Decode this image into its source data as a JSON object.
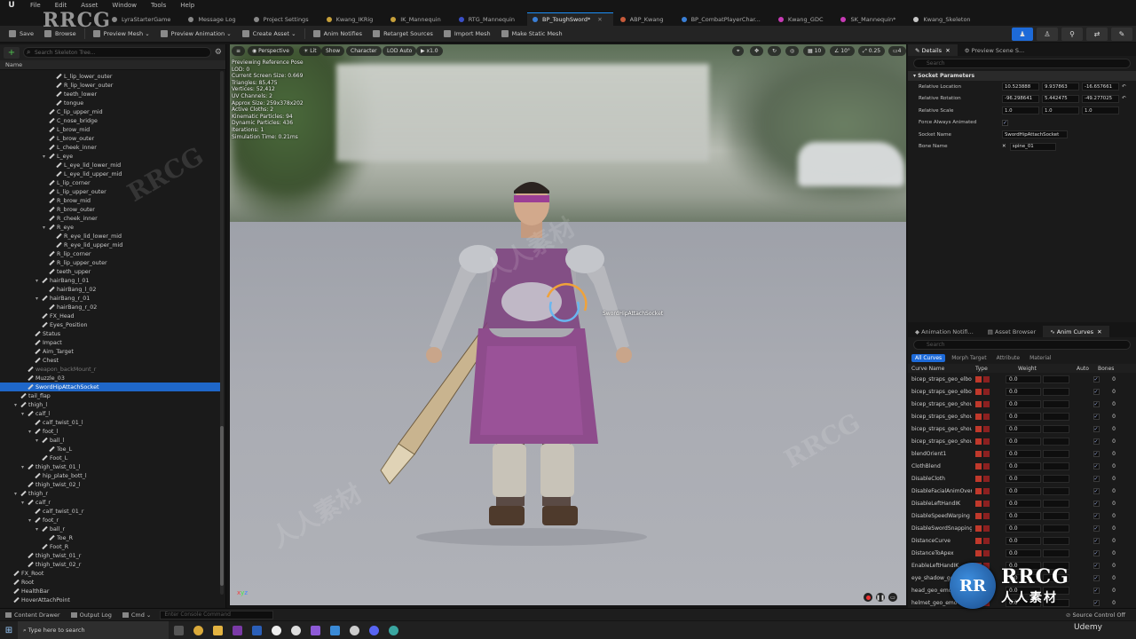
{
  "menubar": {
    "items": [
      "File",
      "Edit",
      "Asset",
      "Window",
      "Tools",
      "Help"
    ]
  },
  "tabs": [
    {
      "label": "LyraStarterGame",
      "color": "#888888",
      "active": false
    },
    {
      "label": "Message Log",
      "color": "#888888",
      "active": false
    },
    {
      "label": "Project Settings",
      "color": "#888888",
      "active": false
    },
    {
      "label": "Kwang_IKRig",
      "color": "#c7a03a",
      "active": false
    },
    {
      "label": "IK_Mannequin",
      "color": "#c7a03a",
      "active": false
    },
    {
      "label": "RTG_Mannequin",
      "color": "#3a4fc7",
      "active": false
    },
    {
      "label": "BP_ToughSword*",
      "color": "#3a7fd6",
      "active": true
    },
    {
      "label": "ABP_Kwang",
      "color": "#c75a3a",
      "active": false
    },
    {
      "label": "BP_CombatPlayerChar...",
      "color": "#3a7fd6",
      "active": false
    },
    {
      "label": "Kwang_GDC",
      "color": "#c73ab5",
      "active": false
    },
    {
      "label": "SK_Mannequin*",
      "color": "#c73ab5",
      "active": false
    },
    {
      "label": "Kwang_Skeleton",
      "color": "#c7c7c7",
      "active": false
    }
  ],
  "toolbar": {
    "buttons": [
      "Save",
      "Browse",
      "Preview Mesh",
      "Preview Animation",
      "Create Asset",
      "Anim Notifies",
      "Retarget Sources",
      "Import Mesh",
      "Make Static Mesh"
    ]
  },
  "left": {
    "search_placeholder": "Search Skeleton Tree...",
    "column_name": "Name",
    "tree": [
      {
        "label": "L_lip_lower_outer",
        "indent": 7,
        "caret": false
      },
      {
        "label": "R_lip_lower_outer",
        "indent": 7,
        "caret": false
      },
      {
        "label": "teeth_lower",
        "indent": 7,
        "caret": false
      },
      {
        "label": "tongue",
        "indent": 7,
        "caret": false
      },
      {
        "label": "C_lip_upper_mid",
        "indent": 6,
        "caret": false
      },
      {
        "label": "C_nose_bridge",
        "indent": 6,
        "caret": false
      },
      {
        "label": "L_brow_mid",
        "indent": 6,
        "caret": false
      },
      {
        "label": "L_brow_outer",
        "indent": 6,
        "caret": false
      },
      {
        "label": "L_cheek_inner",
        "indent": 6,
        "caret": false
      },
      {
        "label": "L_eye",
        "indent": 6,
        "caret": true
      },
      {
        "label": "L_eye_lid_lower_mid",
        "indent": 7,
        "caret": false
      },
      {
        "label": "L_eye_lid_upper_mid",
        "indent": 7,
        "caret": false
      },
      {
        "label": "L_lip_corner",
        "indent": 6,
        "caret": false
      },
      {
        "label": "L_lip_upper_outer",
        "indent": 6,
        "caret": false
      },
      {
        "label": "R_brow_mid",
        "indent": 6,
        "caret": false
      },
      {
        "label": "R_brow_outer",
        "indent": 6,
        "caret": false
      },
      {
        "label": "R_cheek_inner",
        "indent": 6,
        "caret": false
      },
      {
        "label": "R_eye",
        "indent": 6,
        "caret": true
      },
      {
        "label": "R_eye_lid_lower_mid",
        "indent": 7,
        "caret": false
      },
      {
        "label": "R_eye_lid_upper_mid",
        "indent": 7,
        "caret": false
      },
      {
        "label": "R_lip_corner",
        "indent": 6,
        "caret": false
      },
      {
        "label": "R_lip_upper_outer",
        "indent": 6,
        "caret": false
      },
      {
        "label": "teeth_upper",
        "indent": 6,
        "caret": false
      },
      {
        "label": "hairBang_l_01",
        "indent": 5,
        "caret": true
      },
      {
        "label": "hairBang_l_02",
        "indent": 6,
        "caret": false
      },
      {
        "label": "hairBang_r_01",
        "indent": 5,
        "caret": true
      },
      {
        "label": "hairBang_r_02",
        "indent": 6,
        "caret": false
      },
      {
        "label": "FX_Head",
        "indent": 5,
        "caret": false
      },
      {
        "label": "Eyes_Position",
        "indent": 5,
        "caret": false
      },
      {
        "label": "Status",
        "indent": 4,
        "caret": false
      },
      {
        "label": "Impact",
        "indent": 4,
        "caret": false
      },
      {
        "label": "Aim_Target",
        "indent": 4,
        "caret": false
      },
      {
        "label": "Chest",
        "indent": 4,
        "caret": false
      },
      {
        "label": "weapon_backMount_r",
        "indent": 3,
        "caret": false,
        "dim": true
      },
      {
        "label": "Muzzle_03",
        "indent": 3,
        "caret": false
      },
      {
        "label": "SwordHipAttachSocket",
        "indent": 3,
        "caret": false,
        "selected": true
      },
      {
        "label": "tail_flap",
        "indent": 2,
        "caret": false
      },
      {
        "label": "thigh_l",
        "indent": 2,
        "caret": true
      },
      {
        "label": "calf_l",
        "indent": 3,
        "caret": true
      },
      {
        "label": "calf_twist_01_l",
        "indent": 4,
        "caret": false
      },
      {
        "label": "foot_l",
        "indent": 4,
        "caret": true
      },
      {
        "label": "ball_l",
        "indent": 5,
        "caret": true
      },
      {
        "label": "Toe_L",
        "indent": 6,
        "caret": false
      },
      {
        "label": "Foot_L",
        "indent": 5,
        "caret": false
      },
      {
        "label": "thigh_twist_01_l",
        "indent": 3,
        "caret": true
      },
      {
        "label": "hip_plate_bott_l",
        "indent": 4,
        "caret": false
      },
      {
        "label": "thigh_twist_02_l",
        "indent": 3,
        "caret": false
      },
      {
        "label": "thigh_r",
        "indent": 2,
        "caret": true
      },
      {
        "label": "calf_r",
        "indent": 3,
        "caret": true
      },
      {
        "label": "calf_twist_01_r",
        "indent": 4,
        "caret": false
      },
      {
        "label": "foot_r",
        "indent": 4,
        "caret": true
      },
      {
        "label": "ball_r",
        "indent": 5,
        "caret": true
      },
      {
        "label": "Toe_R",
        "indent": 6,
        "caret": false
      },
      {
        "label": "Foot_R",
        "indent": 5,
        "caret": false
      },
      {
        "label": "thigh_twist_01_r",
        "indent": 3,
        "caret": false
      },
      {
        "label": "thigh_twist_02_r",
        "indent": 3,
        "caret": false
      },
      {
        "label": "FX_Root",
        "indent": 1,
        "caret": false
      },
      {
        "label": "Root",
        "indent": 1,
        "caret": false
      },
      {
        "label": "HealthBar",
        "indent": 1,
        "caret": false
      },
      {
        "label": "HoverAttachPoint",
        "indent": 1,
        "caret": false
      }
    ]
  },
  "viewport": {
    "perspective": "Perspective",
    "lit": "Lit",
    "show": "Show",
    "character": "Character",
    "lod": "LOD Auto",
    "speed": "x1.0",
    "grid_snap": "10",
    "rot_snap": "10°",
    "scale_snap": "0.25",
    "cam_speed": "4",
    "stats": [
      "Previewing Reference Pose",
      "LOD: 0",
      "Current Screen Size: 0.669",
      "Triangles: 85,475",
      "Vertices: 52,412",
      "UV Channels: 2",
      "Approx Size: 259x378x202",
      "Active Cloths: 2",
      "Kinematic Particles: 94",
      "Dynamic Particles: 436",
      "Iterations: 1",
      "Simulation Time: 0.21ms"
    ],
    "socket_label": "SwordHipAttachSocket"
  },
  "details": {
    "tab": "Details",
    "tab2": "Preview Scene S...",
    "search_placeholder": "Search",
    "section": "Socket Parameters",
    "rows": {
      "location_label": "Relative Location",
      "location": [
        "10.523888",
        "9.937863",
        "-16.657661"
      ],
      "rotation_label": "Relative Rotation",
      "rotation": [
        "-96.298641",
        "5.442475",
        "-49.277025"
      ],
      "scale_label": "Relative Scale",
      "scale": [
        "1.0",
        "1.0",
        "1.0"
      ],
      "force_label": "Force Always Animated",
      "socket_name_label": "Socket Name",
      "socket_name": "SwordHipAttachSocket",
      "bone_name_label": "Bone Name",
      "bone_name": "spine_01"
    }
  },
  "anim_curves": {
    "tabs": [
      "Animation Notifi...",
      "Asset Browser",
      "Anim Curves"
    ],
    "search_placeholder": "Search",
    "filters": [
      "All Curves",
      "Morph Target",
      "Attribute",
      "Material"
    ],
    "headers": [
      "Curve Name",
      "Type",
      "Weight",
      "Auto",
      "Bones"
    ],
    "rows": [
      {
        "name": "bicep_straps_geo_elbow",
        "weight": "0.0",
        "bones": "0"
      },
      {
        "name": "bicep_straps_geo_elbow",
        "weight": "0.0",
        "bones": "0"
      },
      {
        "name": "bicep_straps_geo_shoul",
        "weight": "0.0",
        "bones": "0"
      },
      {
        "name": "bicep_straps_geo_shoul",
        "weight": "0.0",
        "bones": "0"
      },
      {
        "name": "bicep_straps_geo_shoul",
        "weight": "0.0",
        "bones": "0"
      },
      {
        "name": "bicep_straps_geo_shoul",
        "weight": "0.0",
        "bones": "0"
      },
      {
        "name": "blendOrient1",
        "weight": "0.0",
        "bones": "0"
      },
      {
        "name": "ClothBlend",
        "weight": "0.0",
        "bones": "0"
      },
      {
        "name": "DisableCloth",
        "weight": "0.0",
        "bones": "0"
      },
      {
        "name": "DisableFacialAnimOverr",
        "weight": "0.0",
        "bones": "0"
      },
      {
        "name": "DisableLeftHandIK",
        "weight": "0.0",
        "bones": "0"
      },
      {
        "name": "DisableSpeedWarping",
        "weight": "0.0",
        "bones": "0"
      },
      {
        "name": "DisableSwordSnapping1",
        "weight": "0.0",
        "bones": "0"
      },
      {
        "name": "DistanceCurve",
        "weight": "0.0",
        "bones": "0"
      },
      {
        "name": "DistanceToApex",
        "weight": "0.0",
        "bones": "0"
      },
      {
        "name": "EnableLeftHandIK",
        "weight": "0.0",
        "bones": "0"
      },
      {
        "name": "eye_shadow_geo",
        "weight": "0.0",
        "bones": "0"
      },
      {
        "name": "head_geo_emote",
        "weight": "0.0",
        "bones": "0"
      },
      {
        "name": "helmet_geo_emo",
        "weight": "0.0",
        "bones": "0"
      }
    ]
  },
  "status": {
    "content_drawer": "Content Drawer",
    "output_log": "Output Log",
    "cmd": "Cmd",
    "console_placeholder": "Enter Console Command",
    "source_control": "Source Control Off"
  },
  "taskbar": {
    "search": "Type here to search",
    "udemy": "Udemy"
  },
  "watermark": {
    "main": "RRCG",
    "sub": "人人素材"
  }
}
